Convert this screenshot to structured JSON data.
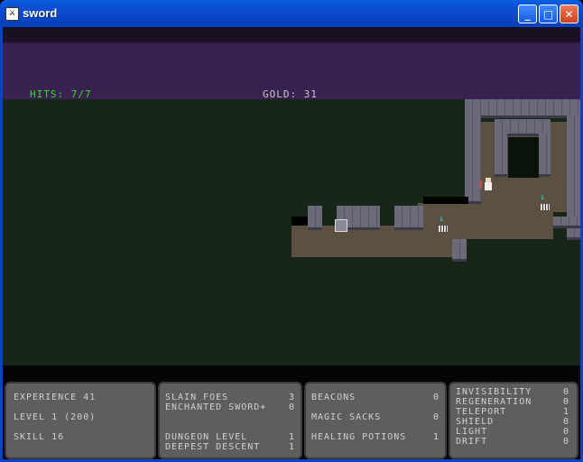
{
  "window": {
    "title": "sword",
    "icon_name": "app-icon"
  },
  "hud": {
    "hits_label": "HITS: 7/7",
    "gold_label": "GOLD: 31"
  },
  "panels": {
    "stats": {
      "experience": "EXPERIENCE 41",
      "level": "LEVEL 1 (200)",
      "skill": "SKILL 16"
    },
    "progress": [
      {
        "label": "SLAIN FOES",
        "value": "3"
      },
      {
        "label": "ENCHANTED SWORD+",
        "value": "0"
      },
      {
        "label": "DUNGEON LEVEL",
        "value": "1"
      },
      {
        "label": "DEEPEST DESCENT",
        "value": "1"
      }
    ],
    "items": [
      {
        "label": "BEACONS",
        "value": "0"
      },
      {
        "label": "MAGIC SACKS",
        "value": "0"
      },
      {
        "label": "HEALING POTIONS",
        "value": "1"
      }
    ],
    "powers": [
      {
        "label": "INVISIBILITY",
        "value": "0"
      },
      {
        "label": "REGENERATION",
        "value": "0"
      },
      {
        "label": "TELEPORT",
        "value": "1"
      },
      {
        "label": "SHIELD",
        "value": "0"
      },
      {
        "label": "LIGHT",
        "value": "0"
      },
      {
        "label": "DRIFT",
        "value": "0"
      }
    ]
  },
  "colors": {
    "hits": "#30e020",
    "gold": "#c8c8c8",
    "panel": "#5e5e5e"
  }
}
